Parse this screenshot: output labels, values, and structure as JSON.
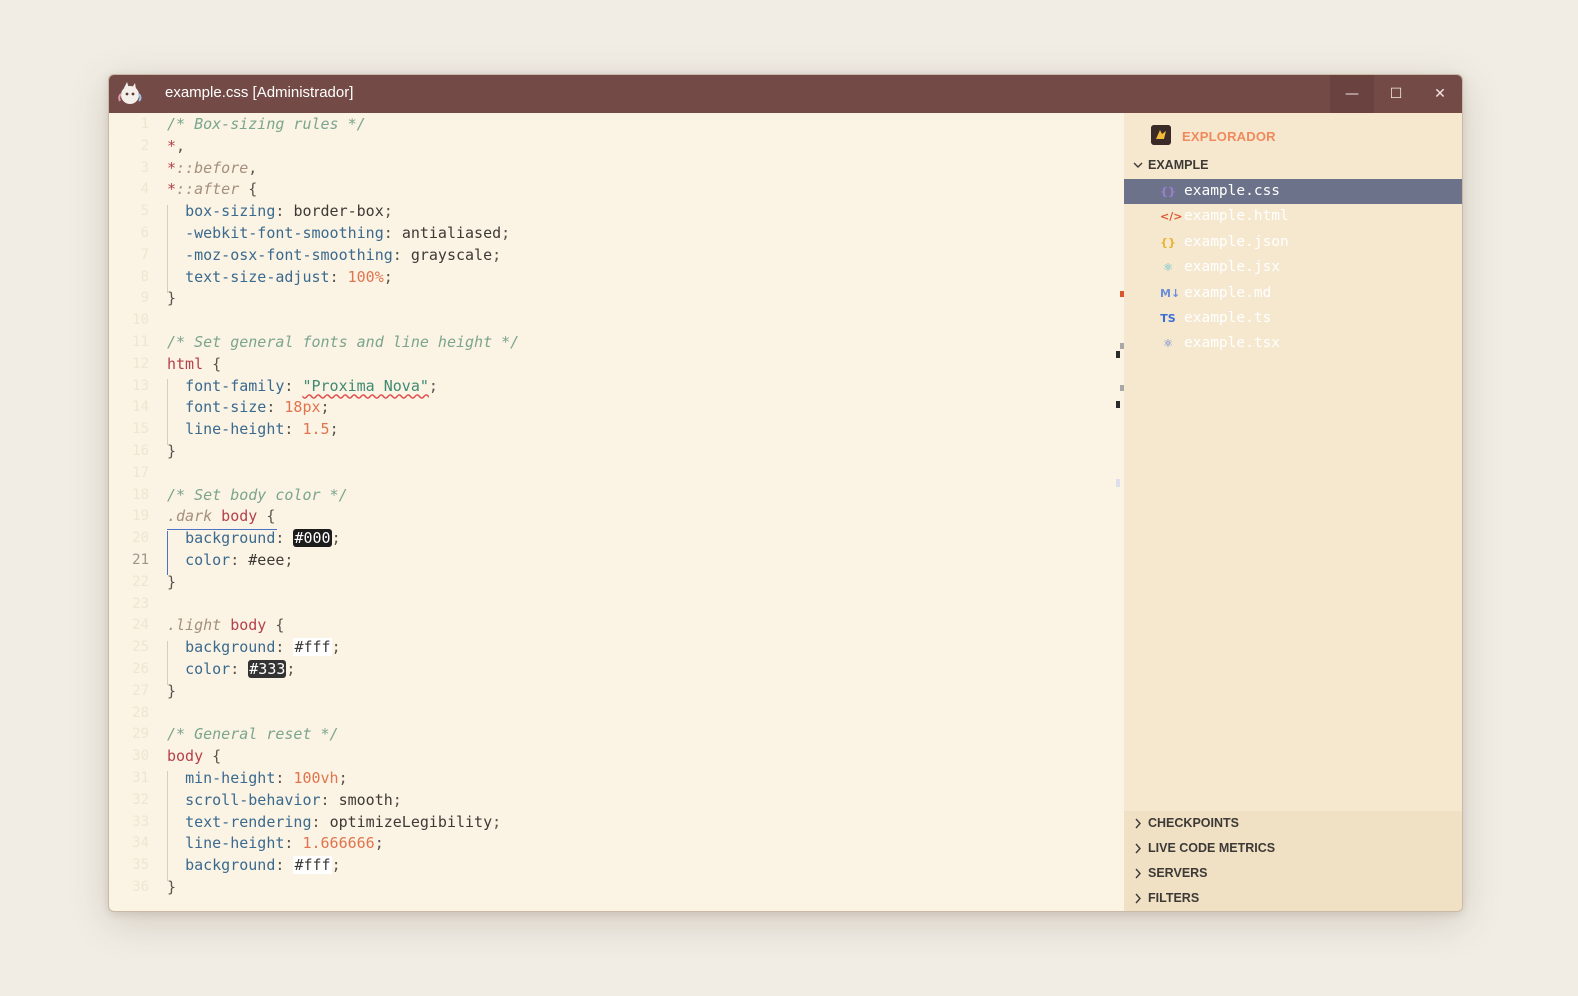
{
  "window": {
    "title": "example.css [Administrador]",
    "controls": {
      "minimize": "—",
      "maximize": "☐",
      "close": "✕"
    }
  },
  "editor": {
    "active_line_number": "21",
    "lines": [
      {
        "n": "1",
        "tokens": [
          [
            "c-comment",
            "/* Box-sizing rules */"
          ]
        ]
      },
      {
        "n": "2",
        "tokens": [
          [
            "c-sel",
            "*"
          ],
          [
            "c-punc",
            ","
          ]
        ]
      },
      {
        "n": "3",
        "tokens": [
          [
            "c-sel",
            "*"
          ],
          [
            "c-selp",
            "::before"
          ],
          [
            "c-punc",
            ","
          ]
        ]
      },
      {
        "n": "4",
        "tokens": [
          [
            "c-sel",
            "*"
          ],
          [
            "c-selp",
            "::after"
          ],
          [
            "c-punc",
            " {"
          ]
        ]
      },
      {
        "n": "5",
        "tokens": [
          [
            "c-val",
            "  "
          ],
          [
            "c-prop",
            "box-sizing"
          ],
          [
            "c-punc",
            ": "
          ],
          [
            "c-val",
            "border-box"
          ],
          [
            "c-punc",
            ";"
          ]
        ]
      },
      {
        "n": "6",
        "tokens": [
          [
            "c-val",
            "  "
          ],
          [
            "c-prop",
            "-webkit-font-smoothing"
          ],
          [
            "c-punc",
            ": "
          ],
          [
            "c-val",
            "antialiased"
          ],
          [
            "c-punc",
            ";"
          ]
        ]
      },
      {
        "n": "7",
        "tokens": [
          [
            "c-val",
            "  "
          ],
          [
            "c-prop",
            "-moz-osx-font-smoothing"
          ],
          [
            "c-punc",
            ": "
          ],
          [
            "c-val",
            "grayscale"
          ],
          [
            "c-punc",
            ";"
          ]
        ]
      },
      {
        "n": "8",
        "tokens": [
          [
            "c-val",
            "  "
          ],
          [
            "c-prop",
            "text-size-adjust"
          ],
          [
            "c-punc",
            ": "
          ],
          [
            "c-num",
            "100%"
          ],
          [
            "c-punc",
            ";"
          ]
        ]
      },
      {
        "n": "9",
        "tokens": [
          [
            "c-punc",
            "}"
          ]
        ]
      },
      {
        "n": "10",
        "tokens": []
      },
      {
        "n": "11",
        "tokens": [
          [
            "c-comment",
            "/* Set general fonts and line height */"
          ]
        ]
      },
      {
        "n": "12",
        "tokens": [
          [
            "c-sel",
            "html"
          ],
          [
            "c-punc",
            " {"
          ]
        ]
      },
      {
        "n": "13",
        "tokens": [
          [
            "c-val",
            "  "
          ],
          [
            "c-prop",
            "font-family"
          ],
          [
            "c-punc",
            ": "
          ],
          [
            "c-str",
            "\"Proxima Nova\""
          ],
          [
            "c-punc",
            ";"
          ]
        ]
      },
      {
        "n": "14",
        "tokens": [
          [
            "c-val",
            "  "
          ],
          [
            "c-prop",
            "font-size"
          ],
          [
            "c-punc",
            ": "
          ],
          [
            "c-num",
            "18px"
          ],
          [
            "c-punc",
            ";"
          ]
        ]
      },
      {
        "n": "15",
        "tokens": [
          [
            "c-val",
            "  "
          ],
          [
            "c-prop",
            "line-height"
          ],
          [
            "c-punc",
            ": "
          ],
          [
            "c-num",
            "1.5"
          ],
          [
            "c-punc",
            ";"
          ]
        ]
      },
      {
        "n": "16",
        "tokens": [
          [
            "c-punc",
            "}"
          ]
        ]
      },
      {
        "n": "17",
        "tokens": []
      },
      {
        "n": "18",
        "tokens": [
          [
            "c-comment",
            "/* Set body color */"
          ]
        ]
      },
      {
        "n": "19",
        "tokens": [
          [
            "c-selp",
            ".dark"
          ],
          [
            "c-sel",
            " body"
          ],
          [
            "c-punc",
            " {"
          ]
        ]
      },
      {
        "n": "20",
        "tokens": [
          [
            "c-val",
            "  "
          ],
          [
            "c-prop",
            "background"
          ],
          [
            "c-punc",
            ": "
          ],
          [
            "swatch-dark",
            "#000"
          ],
          [
            "c-punc",
            ";"
          ]
        ]
      },
      {
        "n": "21",
        "tokens": [
          [
            "c-val",
            "  "
          ],
          [
            "c-prop",
            "color"
          ],
          [
            "c-punc",
            ": "
          ],
          [
            "c-val",
            "#eee"
          ],
          [
            "c-punc",
            ";"
          ]
        ]
      },
      {
        "n": "22",
        "tokens": [
          [
            "c-punc",
            "}"
          ]
        ]
      },
      {
        "n": "23",
        "tokens": []
      },
      {
        "n": "24",
        "tokens": [
          [
            "c-selp",
            ".light"
          ],
          [
            "c-sel",
            " body"
          ],
          [
            "c-punc",
            " {"
          ]
        ]
      },
      {
        "n": "25",
        "tokens": [
          [
            "c-val",
            "  "
          ],
          [
            "c-prop",
            "background"
          ],
          [
            "c-punc",
            ": "
          ],
          [
            "swatch-light",
            "#fff"
          ],
          [
            "c-punc",
            ";"
          ]
        ]
      },
      {
        "n": "26",
        "tokens": [
          [
            "c-val",
            "  "
          ],
          [
            "c-prop",
            "color"
          ],
          [
            "c-punc",
            ": "
          ],
          [
            "swatch-333",
            "#333"
          ],
          [
            "c-punc",
            ";"
          ]
        ]
      },
      {
        "n": "27",
        "tokens": [
          [
            "c-punc",
            "}"
          ]
        ]
      },
      {
        "n": "28",
        "tokens": []
      },
      {
        "n": "29",
        "tokens": [
          [
            "c-comment",
            "/* General reset */"
          ]
        ]
      },
      {
        "n": "30",
        "tokens": [
          [
            "c-sel",
            "body"
          ],
          [
            "c-punc",
            " {"
          ]
        ]
      },
      {
        "n": "31",
        "tokens": [
          [
            "c-val",
            "  "
          ],
          [
            "c-prop",
            "min-height"
          ],
          [
            "c-punc",
            ": "
          ],
          [
            "c-num",
            "100vh"
          ],
          [
            "c-punc",
            ";"
          ]
        ]
      },
      {
        "n": "32",
        "tokens": [
          [
            "c-val",
            "  "
          ],
          [
            "c-prop",
            "scroll-behavior"
          ],
          [
            "c-punc",
            ": "
          ],
          [
            "c-val",
            "smooth"
          ],
          [
            "c-punc",
            ";"
          ]
        ]
      },
      {
        "n": "33",
        "tokens": [
          [
            "c-val",
            "  "
          ],
          [
            "c-prop",
            "text-rendering"
          ],
          [
            "c-punc",
            ": "
          ],
          [
            "c-val",
            "optimizeLegibility"
          ],
          [
            "c-punc",
            ";"
          ]
        ]
      },
      {
        "n": "34",
        "tokens": [
          [
            "c-val",
            "  "
          ],
          [
            "c-prop",
            "line-height"
          ],
          [
            "c-punc",
            ": "
          ],
          [
            "c-num",
            "1.666666"
          ],
          [
            "c-punc",
            ";"
          ]
        ]
      },
      {
        "n": "35",
        "tokens": [
          [
            "c-val",
            "  "
          ],
          [
            "c-prop",
            "background"
          ],
          [
            "c-punc",
            ": "
          ],
          [
            "swatch-light",
            "#fff"
          ],
          [
            "c-punc",
            ";"
          ]
        ]
      },
      {
        "n": "36",
        "tokens": [
          [
            "c-punc",
            "}"
          ]
        ]
      }
    ]
  },
  "sidebar": {
    "title": "EXPLORADOR",
    "folder": "EXAMPLE",
    "files": [
      {
        "name": "example.css",
        "icon": "css-icon",
        "glyph": "{}",
        "color": "#9b7fd6",
        "selected": true
      },
      {
        "name": "example.html",
        "icon": "html-icon",
        "glyph": "</>",
        "color": "#e0562d",
        "selected": false
      },
      {
        "name": "example.json",
        "icon": "json-icon",
        "glyph": "{}",
        "color": "#e8b430",
        "selected": false
      },
      {
        "name": "example.jsx",
        "icon": "react-icon",
        "glyph": "⚛",
        "color": "#3fb8d8",
        "selected": false
      },
      {
        "name": "example.md",
        "icon": "markdown-icon",
        "glyph": "M↓",
        "color": "#6b8fd8",
        "selected": false
      },
      {
        "name": "example.ts",
        "icon": "typescript-icon",
        "glyph": "TS",
        "color": "#3a6fd8",
        "selected": false
      },
      {
        "name": "example.tsx",
        "icon": "react-icon",
        "glyph": "⚛",
        "color": "#4a6fd8",
        "selected": false
      }
    ],
    "sections": [
      "CHECKPOINTS",
      "LIVE CODE METRICS",
      "SERVERS",
      "FILTERS"
    ]
  }
}
